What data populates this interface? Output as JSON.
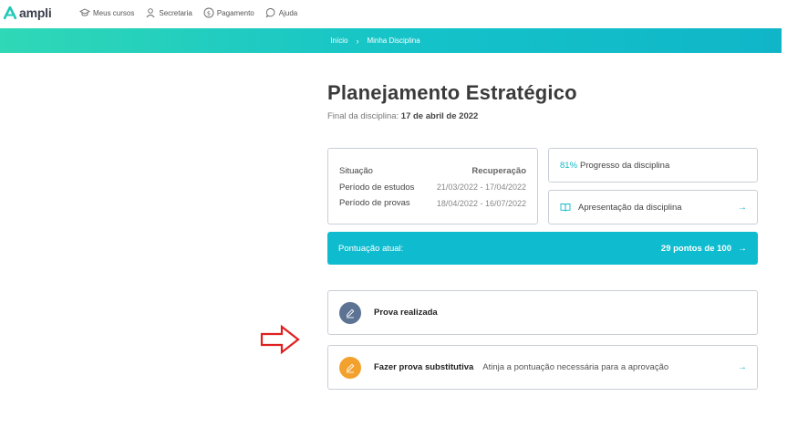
{
  "brand": {
    "name": "ampli",
    "color": "#1fc9b7"
  },
  "nav": {
    "items": [
      {
        "label": "Meus cursos",
        "icon": "graduation-cap-icon"
      },
      {
        "label": "Secretaria",
        "icon": "user-icon"
      },
      {
        "label": "Pagamento",
        "icon": "dollar-circle-icon"
      },
      {
        "label": "Ajuda",
        "icon": "chat-bubble-icon"
      }
    ]
  },
  "breadcrumb": {
    "home": "Início",
    "separator": "›",
    "current": "Minha Disciplina"
  },
  "course": {
    "title": "Planejamento Estratégico",
    "final_label": "Final da disciplina:",
    "final_date": "17 de abril de 2022"
  },
  "status": {
    "rows": [
      {
        "label": "Situação",
        "value": "Recuperação"
      },
      {
        "label": "Período de estudos",
        "value": "21/03/2022 - 17/04/2022"
      },
      {
        "label": "Período de provas",
        "value": "18/04/2022 - 16/07/2022"
      }
    ]
  },
  "progress": {
    "percent": "81%",
    "label": "Progresso da disciplina"
  },
  "presentation": {
    "label": "Apresentação da disciplina",
    "arrow": "→"
  },
  "score": {
    "label": "Pontuação atual:",
    "value": "29 pontos de 100",
    "arrow": "→"
  },
  "exam_done": {
    "title": "Prova realizada"
  },
  "substitute": {
    "title": "Fazer prova substitutiva",
    "description": "Atinja a pontuação necessária para a aprovação",
    "arrow": "→"
  },
  "colors": {
    "accent": "#0fbccf",
    "gradient_start": "#2fd8b6",
    "exam_done": "#5d7394",
    "substitute": "#f3a12d",
    "annotation": "#e02020"
  }
}
